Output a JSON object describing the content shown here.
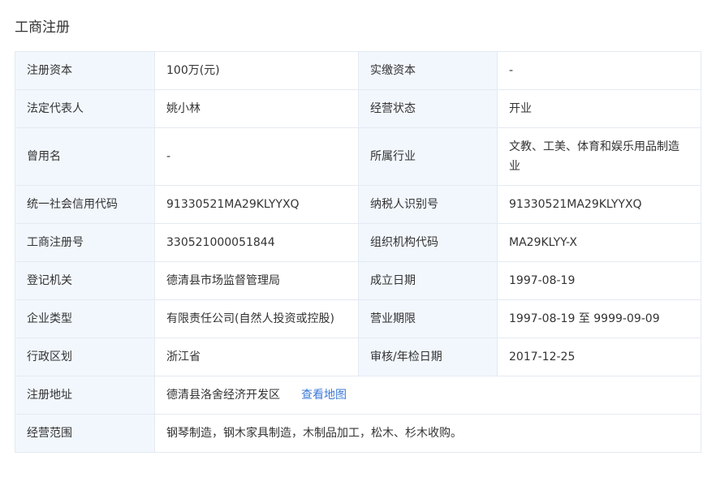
{
  "section": {
    "title": "工商注册"
  },
  "rows": [
    {
      "label1": "注册资本",
      "value1": "100万(元)",
      "label2": "实缴资本",
      "value2": "-"
    },
    {
      "label1": "法定代表人",
      "value1": "姚小林",
      "label2": "经营状态",
      "value2": "开业"
    },
    {
      "label1": "曾用名",
      "value1": "-",
      "label2": "所属行业",
      "value2": "文教、工美、体育和娱乐用品制造业"
    },
    {
      "label1": "统一社会信用代码",
      "value1": "91330521MA29KLYYXQ",
      "label2": "纳税人识别号",
      "value2": "91330521MA29KLYYXQ"
    },
    {
      "label1": "工商注册号",
      "value1": "330521000051844",
      "label2": "组织机构代码",
      "value2": "MA29KLYY-X"
    },
    {
      "label1": "登记机关",
      "value1": "德清县市场监督管理局",
      "label2": "成立日期",
      "value2": "1997-08-19"
    },
    {
      "label1": "企业类型",
      "value1": "有限责任公司(自然人投资或控股)",
      "label2": "营业期限",
      "value2": "1997-08-19 至 9999-09-09"
    },
    {
      "label1": "行政区划",
      "value1": "浙江省",
      "label2": "审核/年检日期",
      "value2": "2017-12-25"
    }
  ],
  "address": {
    "label": "注册地址",
    "value": "德清县洛舍经济开发区",
    "map_link": "查看地图"
  },
  "scope": {
    "label": "经营范围",
    "value": "钢琴制造，钢木家具制造，木制品加工，松木、杉木收购。"
  },
  "colors": {
    "label_bg": "#f2f7fd",
    "border": "#e4eaf2",
    "link": "#3c7ad8"
  }
}
